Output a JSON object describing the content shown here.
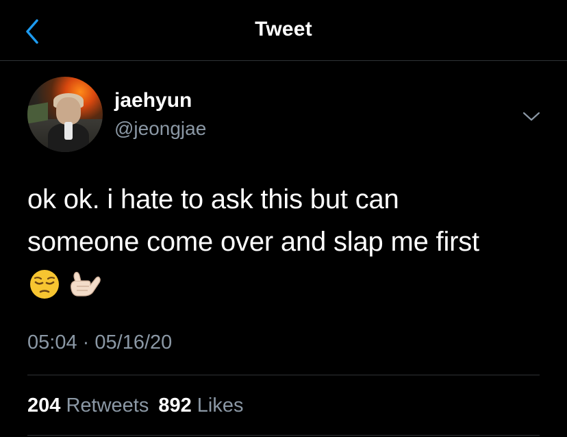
{
  "header": {
    "title": "Tweet",
    "back_icon": "chevron-left-icon",
    "accent_color": "#1d9bf0"
  },
  "tweet": {
    "author": {
      "display_name": "jaehyun",
      "handle": "@jeongjae"
    },
    "text": "ok ok. i hate to ask this but can\nsomeone come over and slap me first",
    "emojis": [
      "pensive-face-emoji",
      "call-me-hand-emoji"
    ],
    "time": "05:04",
    "separator": "·",
    "date": "05/16/20",
    "stats": {
      "retweets_count": "204",
      "retweets_label": "Retweets",
      "likes_count": "892",
      "likes_label": "Likes"
    }
  },
  "colors": {
    "background": "#000000",
    "text": "#ffffff",
    "secondary_text": "#8b98a5",
    "divider": "#2f3336"
  }
}
